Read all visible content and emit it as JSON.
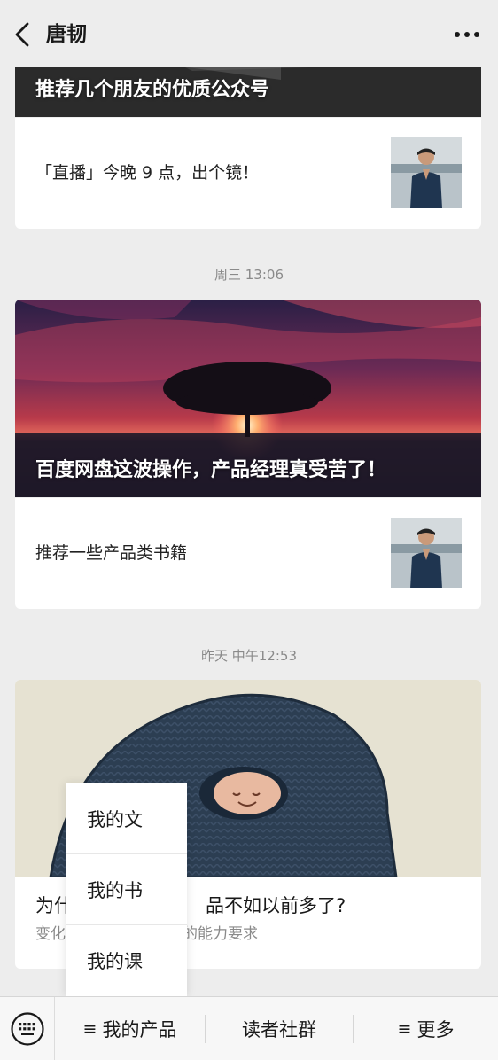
{
  "header": {
    "title": "唐韧",
    "back_icon": "chevron-left-icon",
    "more_icon": "more-dots-icon"
  },
  "feed": {
    "group1": {
      "hero_title": "推荐几个朋友的优质公众号",
      "sub_title": "「直播」今晚 9 点，出个镜！"
    },
    "timestamp2": "周三 13:06",
    "group2": {
      "hero_title": "百度网盘这波操作，产品经理真受苦了！",
      "sub_title": "推荐一些产品类书籍"
    },
    "timestamp3": "昨天 中午12:53",
    "group3": {
      "title_left": "为什",
      "title_right": "品不如以前多了?",
      "desc_left": "变化",
      "desc_right": "的能力要求"
    }
  },
  "popup_menu": {
    "items": [
      "我的文",
      "我的书",
      "我的课"
    ]
  },
  "bottom_menu": {
    "keyboard_icon": "keyboard-icon",
    "items": [
      {
        "label": "我的产品",
        "glyph": "≡"
      },
      {
        "label": "读者社群",
        "glyph": ""
      },
      {
        "label": "更多",
        "glyph": "≡"
      }
    ]
  }
}
